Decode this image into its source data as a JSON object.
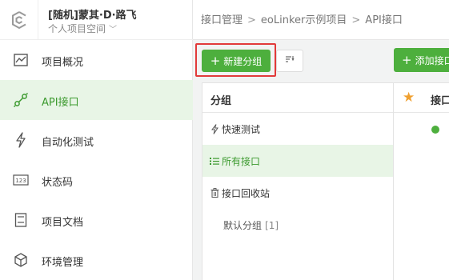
{
  "project": {
    "name": "[随机]蒙其·D·路飞",
    "space": "个人项目空间"
  },
  "nav": {
    "items": [
      {
        "label": "项目概况",
        "icon": "chart-line-icon"
      },
      {
        "label": "API接口",
        "icon": "api-link-icon"
      },
      {
        "label": "自动化测试",
        "icon": "lightning-icon"
      },
      {
        "label": "状态码",
        "icon": "status-code-icon"
      },
      {
        "label": "项目文档",
        "icon": "document-icon"
      },
      {
        "label": "环境管理",
        "icon": "environment-cube-icon"
      }
    ],
    "active_index": 1
  },
  "breadcrumb": {
    "items": [
      "接口管理",
      "eoLinker示例项目",
      "API接口"
    ],
    "separator": ">"
  },
  "toolbar": {
    "new_group_label": "新建分组",
    "add_api_label": "添加接口"
  },
  "groups": {
    "header": "分组",
    "items": [
      {
        "label": "快速测试",
        "icon": "lightning-icon"
      },
      {
        "label": "所有接口",
        "icon": "list-icon"
      },
      {
        "label": "接口回收站",
        "icon": "trash-icon"
      }
    ],
    "active_index": 1,
    "default_group": {
      "label": "默认分组",
      "count": "[1]"
    }
  },
  "list": {
    "header": "接口"
  },
  "colors": {
    "accent_green": "#4daf3d",
    "active_bg": "#e8f5e6",
    "highlight_red": "#e23a3a",
    "star_orange": "#f0a030"
  }
}
